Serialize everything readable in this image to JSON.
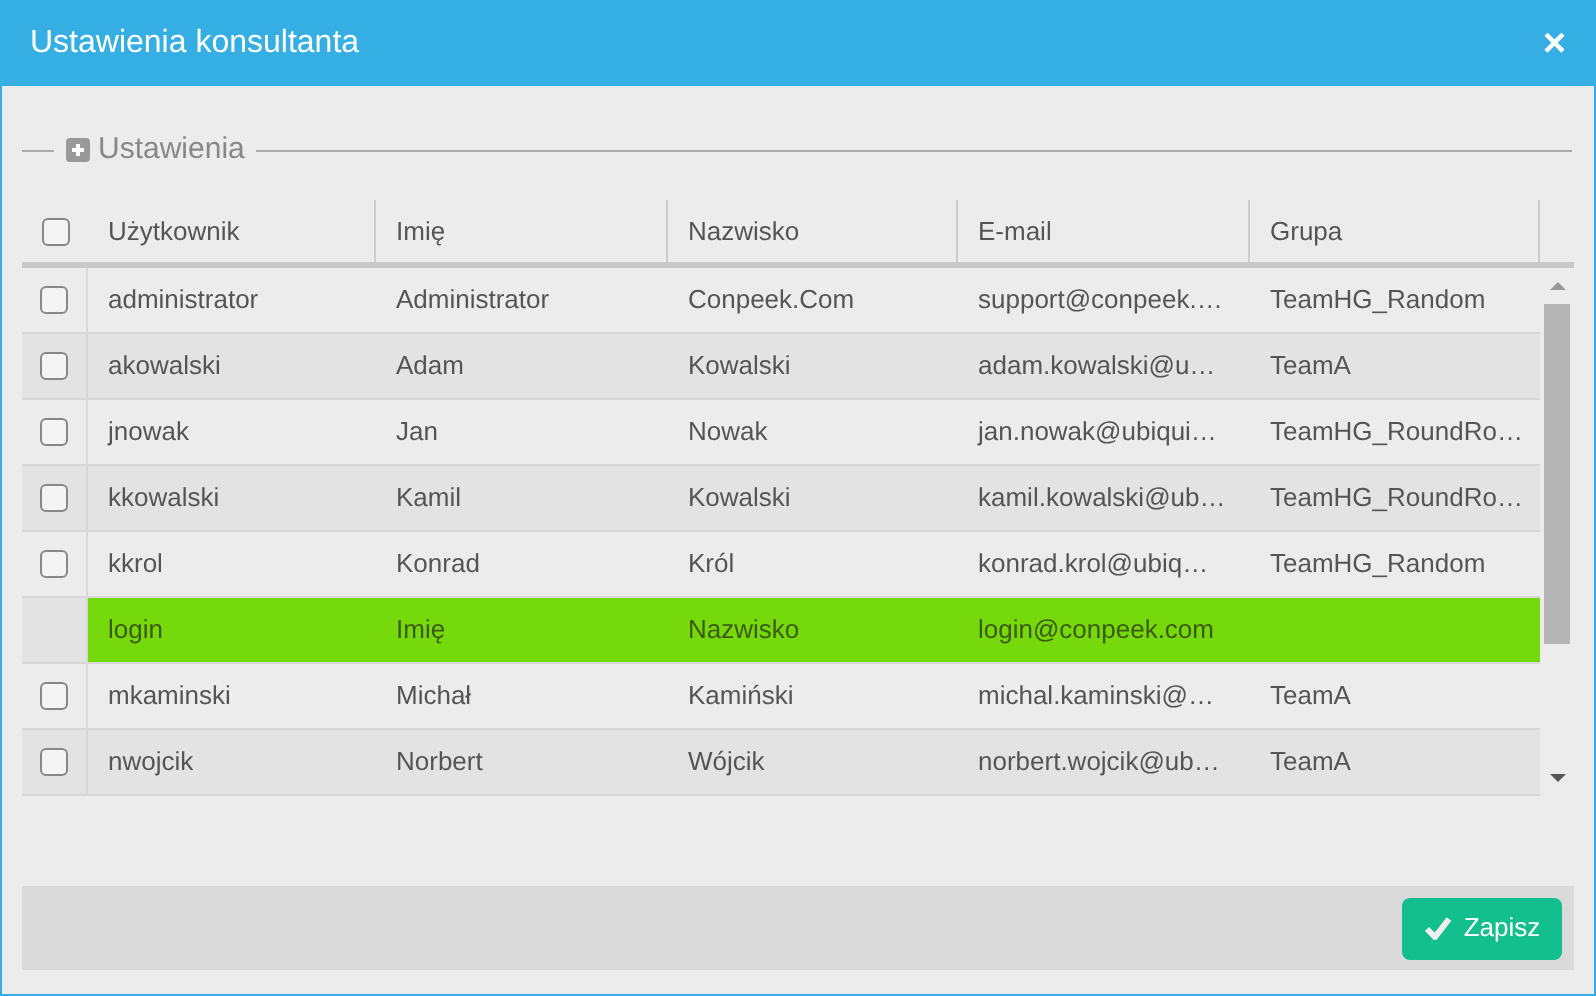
{
  "window": {
    "title": "Ustawienia konsultanta",
    "close": "×"
  },
  "section": {
    "legend": "Ustawienia"
  },
  "table": {
    "header_checkbox": {
      "checked": false
    },
    "columns": [
      "Użytkownik",
      "Imię",
      "Nazwisko",
      "E-mail",
      "Grupa"
    ],
    "rows": [
      {
        "kind": "user",
        "checked": false,
        "selected": false,
        "cells": [
          "administrator",
          "Administrator",
          "Conpeek.Com",
          "support@conpeek.…",
          "TeamHG_Random"
        ]
      },
      {
        "kind": "user",
        "checked": false,
        "selected": false,
        "cells": [
          "akowalski",
          "Adam",
          "Kowalski",
          "adam.kowalski@u…",
          "TeamA"
        ]
      },
      {
        "kind": "user",
        "checked": false,
        "selected": false,
        "cells": [
          "jnowak",
          "Jan",
          "Nowak",
          "jan.nowak@ubiqui…",
          "TeamHG_RoundRo…"
        ]
      },
      {
        "kind": "user",
        "checked": false,
        "selected": false,
        "cells": [
          "kkowalski",
          "Kamil",
          "Kowalski",
          "kamil.kowalski@ub…",
          "TeamHG_RoundRo…"
        ]
      },
      {
        "kind": "user",
        "checked": false,
        "selected": false,
        "cells": [
          "kkrol",
          "Konrad",
          "Król",
          "konrad.krol@ubiq…",
          "TeamHG_Random"
        ]
      },
      {
        "kind": "new",
        "selected": true,
        "cells": [
          "login",
          "Imię",
          "Nazwisko",
          "login@conpeek.com",
          ""
        ]
      },
      {
        "kind": "user",
        "checked": false,
        "selected": false,
        "cells": [
          "mkaminski",
          "Michał",
          "Kamiński",
          "michal.kaminski@…",
          "TeamA"
        ]
      },
      {
        "kind": "user",
        "checked": false,
        "selected": false,
        "cells": [
          "nwojcik",
          "Norbert",
          "Wójcik",
          "norbert.wojcik@ub…",
          "TeamA"
        ]
      }
    ]
  },
  "footer": {
    "save_button": "Zapisz"
  }
}
